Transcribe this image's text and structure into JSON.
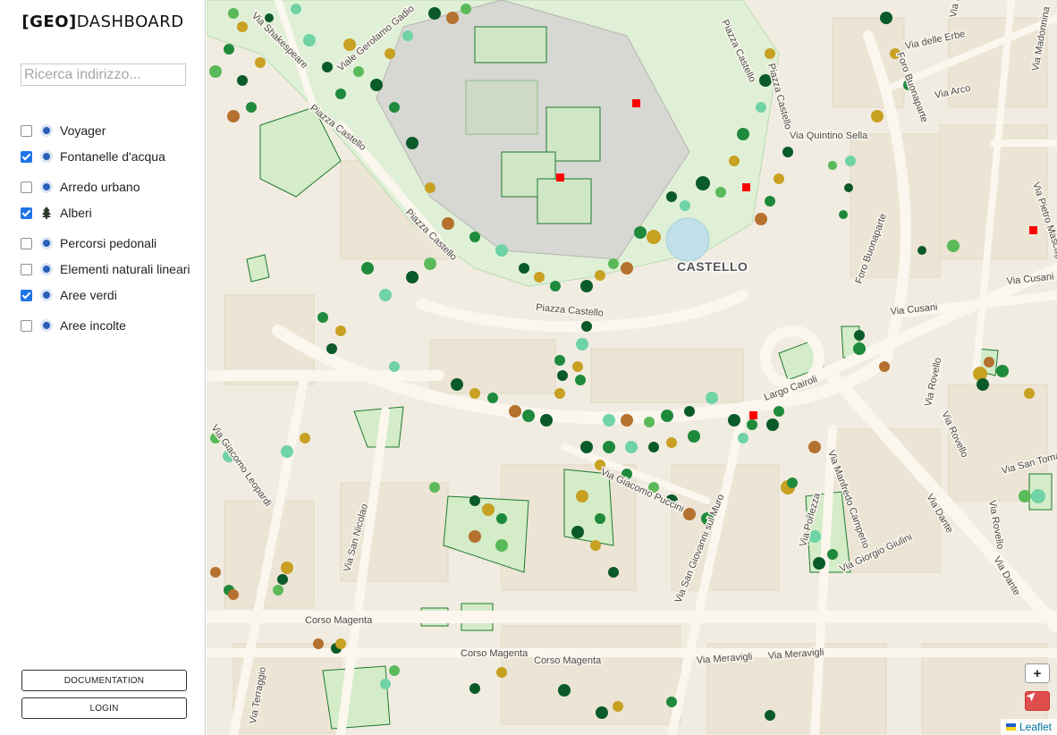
{
  "logo": {
    "bracket_part": "[GEO]",
    "rest": "DASHBOARD"
  },
  "search": {
    "placeholder": "Ricerca indirizzo..."
  },
  "layers": [
    {
      "label": "Voyager",
      "checked": false,
      "icon": "dot-icon"
    },
    {
      "label": "Fontanelle d'acqua",
      "checked": true,
      "icon": "dot-icon"
    },
    {
      "label": "Arredo urbano",
      "checked": false,
      "icon": "dot-icon"
    },
    {
      "label": "Alberi",
      "checked": true,
      "icon": "tree-icon"
    },
    {
      "label": "Percorsi pedonali",
      "checked": false,
      "icon": "dot-icon"
    },
    {
      "label": "Elementi naturali lineari",
      "checked": false,
      "icon": "dot-icon"
    },
    {
      "label": "Aree verdi",
      "checked": true,
      "icon": "dot-icon"
    },
    {
      "label": "Aree incolte",
      "checked": false,
      "icon": "dot-icon"
    }
  ],
  "buttons": {
    "documentation": "DOCUMENTATION",
    "login": "LOGIN"
  },
  "map": {
    "district_label": "CASTELLO",
    "streets": {
      "shakespeare": "Via Shakespeare",
      "gadio": "Viale Gerolamo Gadio",
      "piazza_castello_1": "Piazza Castello",
      "piazza_castello_2": "Piazza Castello",
      "piazza_castello_3": "Piazza Castello",
      "piazza_castello_4": "Piazza Castello",
      "piazza_castello_5": "Piazza Castello",
      "quintino_sella": "Via Quintino Sella",
      "delle_erbe": "Via delle Erbe",
      "arco": "Via Arco",
      "madonnina": "Via Madonnina",
      "pontaccio": "Via Pontaccio",
      "foro_buonaparte_1": "Foro Buonaparte",
      "foro_buonaparte_2": "Foro Buonaparte",
      "pietro_mascagni": "Via Pietro Mascagni",
      "cusani_1": "Via Cusani",
      "cusani_2": "Via Cusani",
      "largo_cairoli": "Largo Cairoli",
      "rovello_1": "Via Rovello",
      "rovello_2": "Via Rovello",
      "rovello_3": "Via Rovello",
      "san_tomaso": "Via San Tomaso",
      "leopardi": "Via Giacomo Leopardi",
      "puccini": "Via Giacomo Puccini",
      "campiero": "Via Manfredo Camperio",
      "dante_1": "Via Dante",
      "dante_2": "Via Dante",
      "san_giovanni": "Via San Giovanni sul Muro",
      "san_nicolao": "Via San Nicolao",
      "porlezza": "Via Porlezza",
      "giulini": "Via Giorgio Giulini",
      "magenta_1": "Corso Magenta",
      "magenta_2": "Corso Magenta",
      "magenta_3": "Corso Magenta",
      "meravigli_1": "Via Meravigli",
      "meravigli_2": "Via Meravigli",
      "terraggio": "Via Terraggio"
    },
    "water_fountains_color": "#ff0000",
    "tree_colors": [
      "#0b5a2a",
      "#1f8a3c",
      "#5aba5a",
      "#6fd3a6",
      "#c8a022",
      "#b5712f",
      "#d7e7a0"
    ],
    "green_area_color": "#1e7a2e",
    "zoom_in_label": "+",
    "attribution": "Leaflet"
  }
}
